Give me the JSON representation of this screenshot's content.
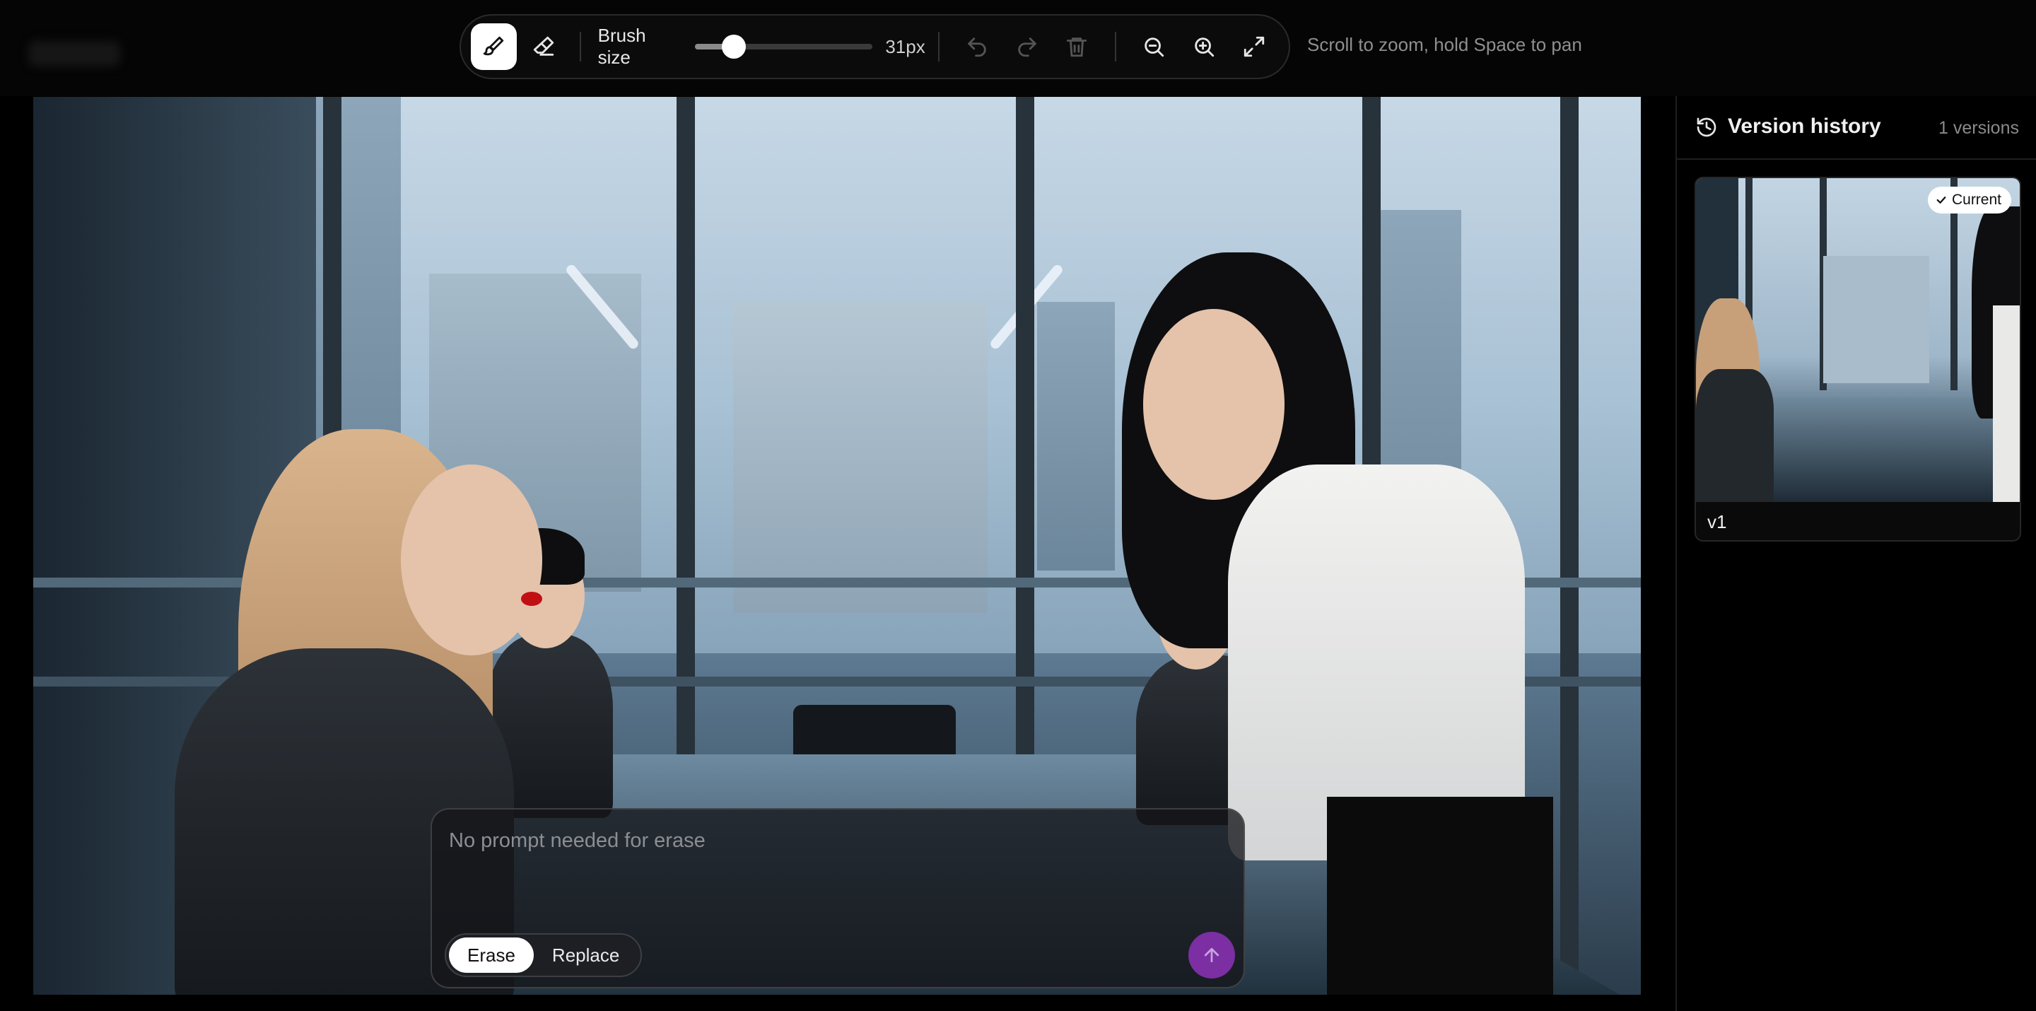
{
  "toolbar": {
    "tools": [
      {
        "name": "brush",
        "icon": "brush-icon",
        "active": true
      },
      {
        "name": "eraser",
        "icon": "eraser-icon",
        "active": false
      }
    ],
    "brush_size_label": "Brush size",
    "brush_size_value": "31px",
    "brush_size_fraction": 0.22,
    "actions": [
      "undo-icon",
      "redo-icon",
      "trash-icon",
      "zoom-out-icon",
      "zoom-in-icon",
      "fullscreen-icon"
    ]
  },
  "hint": "Scroll to zoom, hold Space to pan",
  "prompt": {
    "placeholder": "No prompt needed for erase",
    "modes": [
      "Erase",
      "Replace"
    ],
    "active_mode": "Erase",
    "send_color": "#7b2fa3"
  },
  "sidebar": {
    "title": "Version history",
    "count": "1 versions",
    "versions": [
      {
        "label": "v1",
        "badge": "Current"
      }
    ]
  }
}
